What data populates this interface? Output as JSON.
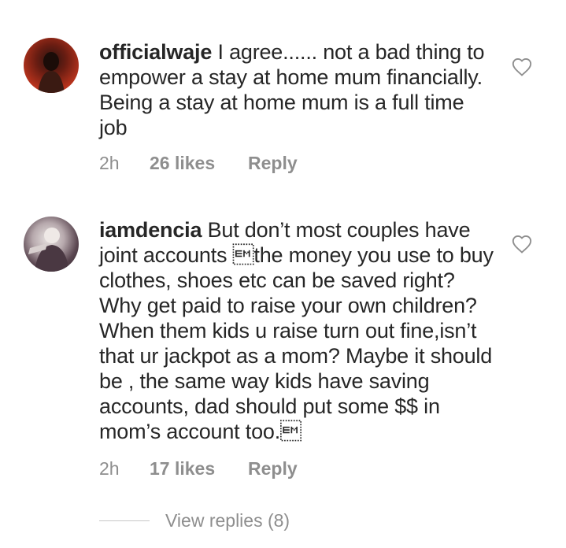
{
  "comments": [
    {
      "username": "officialwaje",
      "text": "I agree...... not a bad thing to empower a stay at home mum financially. Being a stay at home mum is a full time job",
      "time": "2h",
      "likes": "26 likes",
      "reply_label": "Reply",
      "avatar_icon": "avatar-photo"
    },
    {
      "username": "iamdencia",
      "text": "But don’t most couples have joint accounts \u0019the money you use to buy clothes, shoes etc can be saved right? Why get paid to raise your own children? When them kids u raise turn out fine,isn’t that ur jackpot as a mom? Maybe it should be , the same way kids have saving accounts, dad should put some $$ in mom’s account too.\u0019",
      "time": "2h",
      "likes": "17 likes",
      "reply_label": "Reply",
      "avatar_icon": "avatar-photo"
    }
  ],
  "view_replies": "View replies (8)",
  "icons": {
    "like": "heart-outline-icon"
  },
  "colors": {
    "text": "#262626",
    "muted": "#8e8e8e",
    "divider": "#c7c7c7"
  }
}
